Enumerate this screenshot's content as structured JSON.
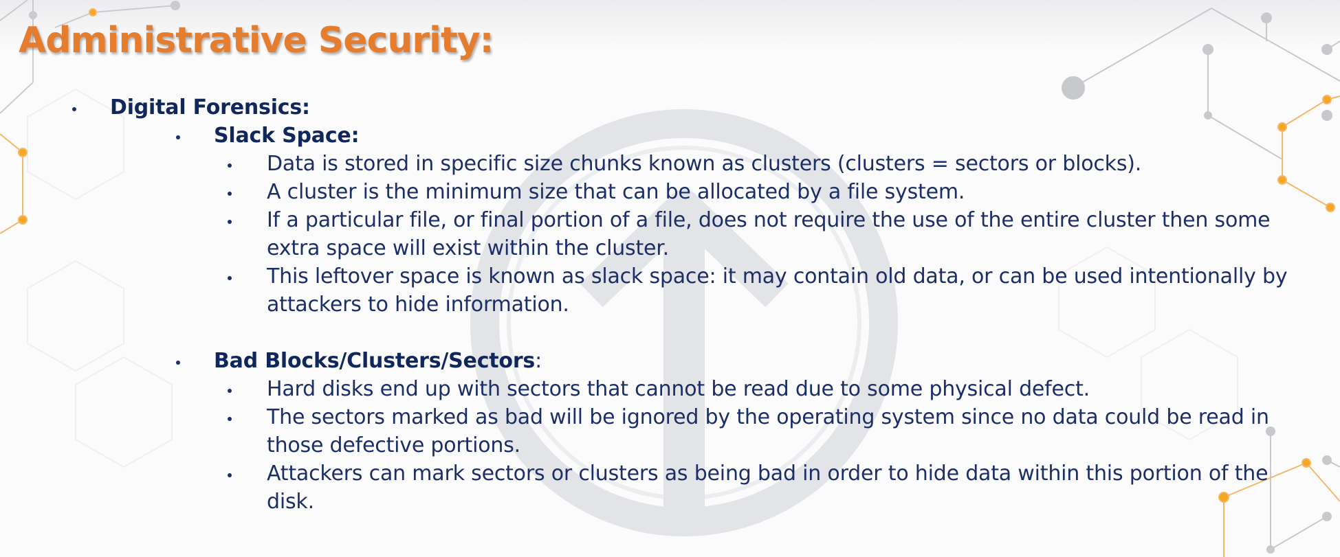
{
  "slide": {
    "title": "Administrative Security:",
    "level1": {
      "label": "Digital Forensics:"
    },
    "slack_space": {
      "label": "Slack Space:",
      "points": [
        "Data is stored in specific size chunks known as clusters (clusters  = sectors or blocks).",
        "A cluster is the minimum size that can be allocated by a file system.",
        "If a particular file, or final portion of a file, does not require the use of the entire cluster then some",
        "extra space will exist within the cluster.",
        "This leftover space is known as slack space: it may contain old data, or can be used intentionally by",
        "attackers to hide information."
      ]
    },
    "bad_blocks": {
      "label": "Bad Blocks/Clusters/Sectors",
      "suffix": ":",
      "points": [
        "Hard disks end up with sectors that cannot be read due to some physical defect.",
        "The sectors marked as bad will be ignored by the operating system since no data could be read in",
        "those defective portions.",
        "Attackers can mark sectors or clusters as being bad in order to hide data within this portion of the",
        "disk."
      ]
    }
  },
  "colors": {
    "title": "#e57d2f",
    "text": "#1b2f66",
    "accent_orange": "#f5a623",
    "decor_gray": "#c7c9cc"
  }
}
